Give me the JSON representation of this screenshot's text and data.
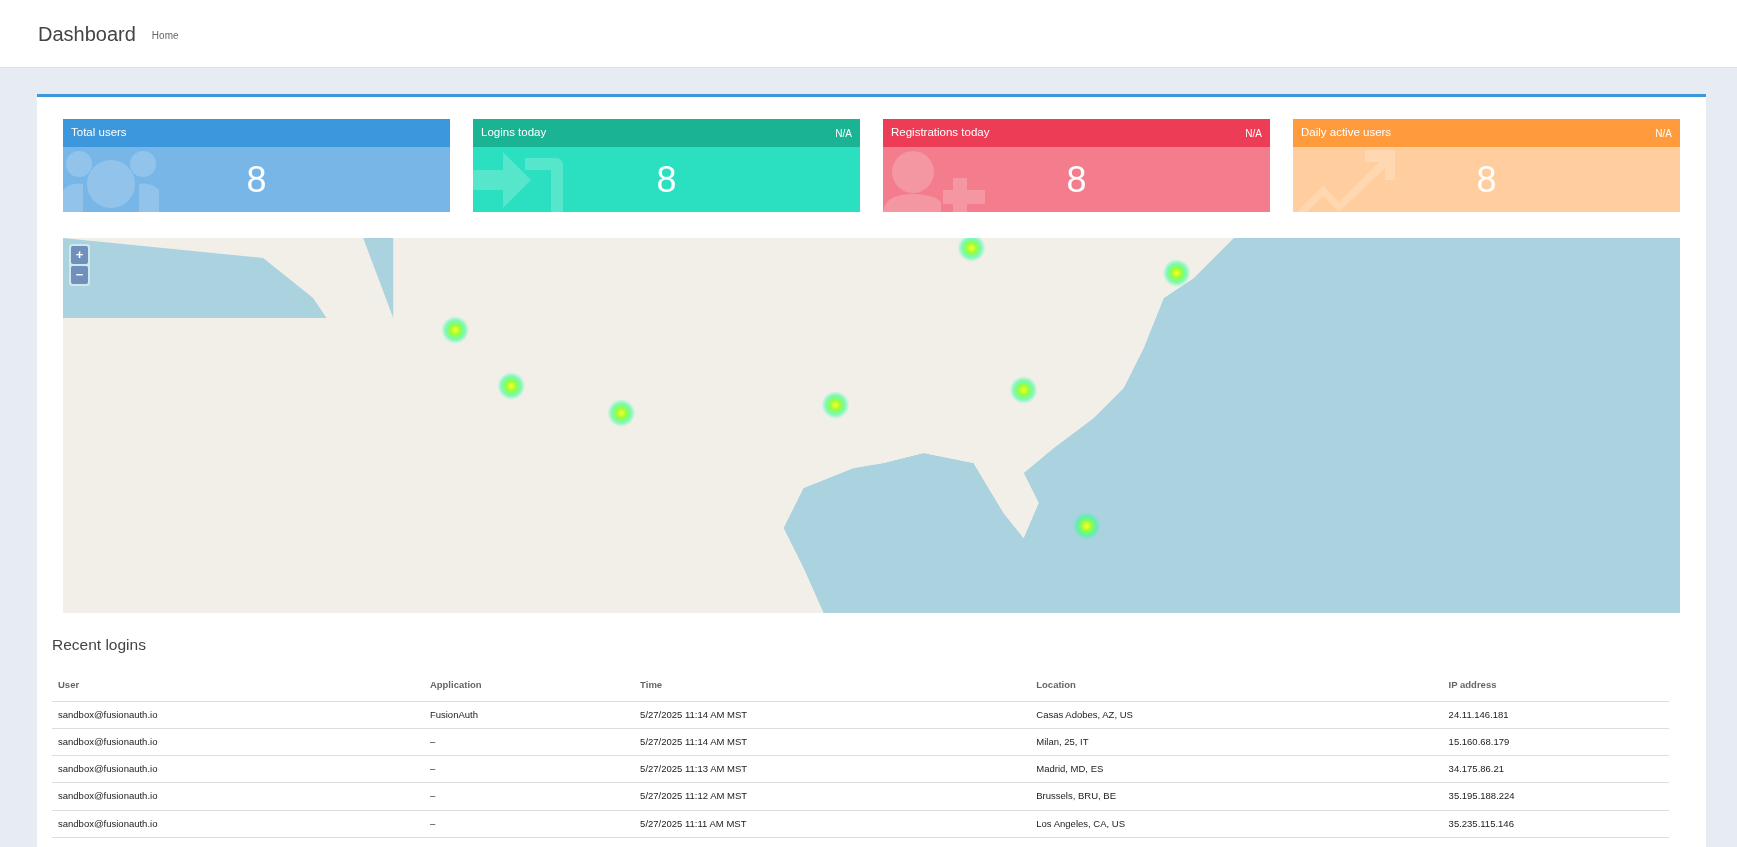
{
  "header": {
    "title": "Dashboard",
    "breadcrumb": "Home"
  },
  "stats": [
    {
      "kind": "users",
      "title": "Total users",
      "value": "8",
      "color": "#3c97dc"
    },
    {
      "kind": "login",
      "title": "Logins today",
      "badge": "N/A",
      "value": "8",
      "color": "#1ab394"
    },
    {
      "kind": "registration",
      "title": "Registrations today",
      "badge": "N/A",
      "value": "8",
      "color": "#ed3c55"
    },
    {
      "kind": "trend",
      "title": "Daily active users",
      "badge": "N/A",
      "value": "8",
      "color": "#ff9b3d"
    }
  ],
  "map": {
    "zoom_in": "+",
    "zoom_out": "−"
  },
  "recent_logins": {
    "title": "Recent logins",
    "columns": [
      "User",
      "Application",
      "Time",
      "Location",
      "IP address"
    ],
    "rows": [
      [
        "sandbox@fusionauth.io",
        "FusionAuth",
        "5/27/2025 11:14 AM MST",
        "Casas Adobes, AZ, US",
        "24.11.146.181"
      ],
      [
        "sandbox@fusionauth.io",
        "–",
        "5/27/2025 11:14 AM MST",
        "Milan, 25, IT",
        "15.160.68.179"
      ],
      [
        "sandbox@fusionauth.io",
        "–",
        "5/27/2025 11:13 AM MST",
        "Madrid, MD, ES",
        "34.175.86.21"
      ],
      [
        "sandbox@fusionauth.io",
        "–",
        "5/27/2025 11:12 AM MST",
        "Brussels, BRU, BE",
        "35.195.188.224"
      ],
      [
        "sandbox@fusionauth.io",
        "–",
        "5/27/2025 11:11 AM MST",
        "Los Angeles, CA, US",
        "35.235.115.146"
      ]
    ]
  }
}
